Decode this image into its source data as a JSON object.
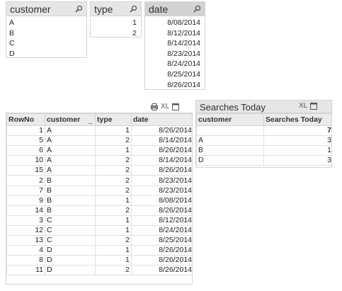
{
  "listboxes": {
    "customer": {
      "title": "customer",
      "values": [
        "A",
        "B",
        "C",
        "D"
      ]
    },
    "type": {
      "title": "type",
      "values": [
        "1",
        "2"
      ]
    },
    "date": {
      "title": "date",
      "values": [
        "8/08/2014",
        "8/12/2014",
        "8/14/2014",
        "8/23/2014",
        "8/24/2014",
        "8/25/2014",
        "8/26/2014"
      ]
    }
  },
  "table": {
    "export_label": "XL",
    "columns": [
      "RowNo",
      "customer",
      "type",
      "date"
    ],
    "rows": [
      [
        "1",
        "A",
        "1",
        "8/26/2014"
      ],
      [
        "5",
        "A",
        "2",
        "8/14/2014"
      ],
      [
        "6",
        "A",
        "1",
        "8/26/2014"
      ],
      [
        "10",
        "A",
        "2",
        "8/14/2014"
      ],
      [
        "15",
        "A",
        "2",
        "8/26/2014"
      ],
      [
        "2",
        "B",
        "2",
        "8/23/2014"
      ],
      [
        "7",
        "B",
        "2",
        "8/23/2014"
      ],
      [
        "9",
        "B",
        "1",
        "8/08/2014"
      ],
      [
        "14",
        "B",
        "2",
        "8/26/2014"
      ],
      [
        "3",
        "C",
        "1",
        "8/12/2014"
      ],
      [
        "12",
        "C",
        "1",
        "8/24/2014"
      ],
      [
        "13",
        "C",
        "2",
        "8/25/2014"
      ],
      [
        "4",
        "D",
        "1",
        "8/26/2014"
      ],
      [
        "8",
        "D",
        "1",
        "8/26/2014"
      ],
      [
        "11",
        "D",
        "2",
        "8/26/2014"
      ]
    ]
  },
  "chart": {
    "title": "Searches Today",
    "export_label": "XL",
    "columns": [
      "customer",
      "Searches Today"
    ],
    "total": "7",
    "rows": [
      [
        "A",
        "3"
      ],
      [
        "B",
        "1"
      ],
      [
        "D",
        "3"
      ]
    ]
  }
}
